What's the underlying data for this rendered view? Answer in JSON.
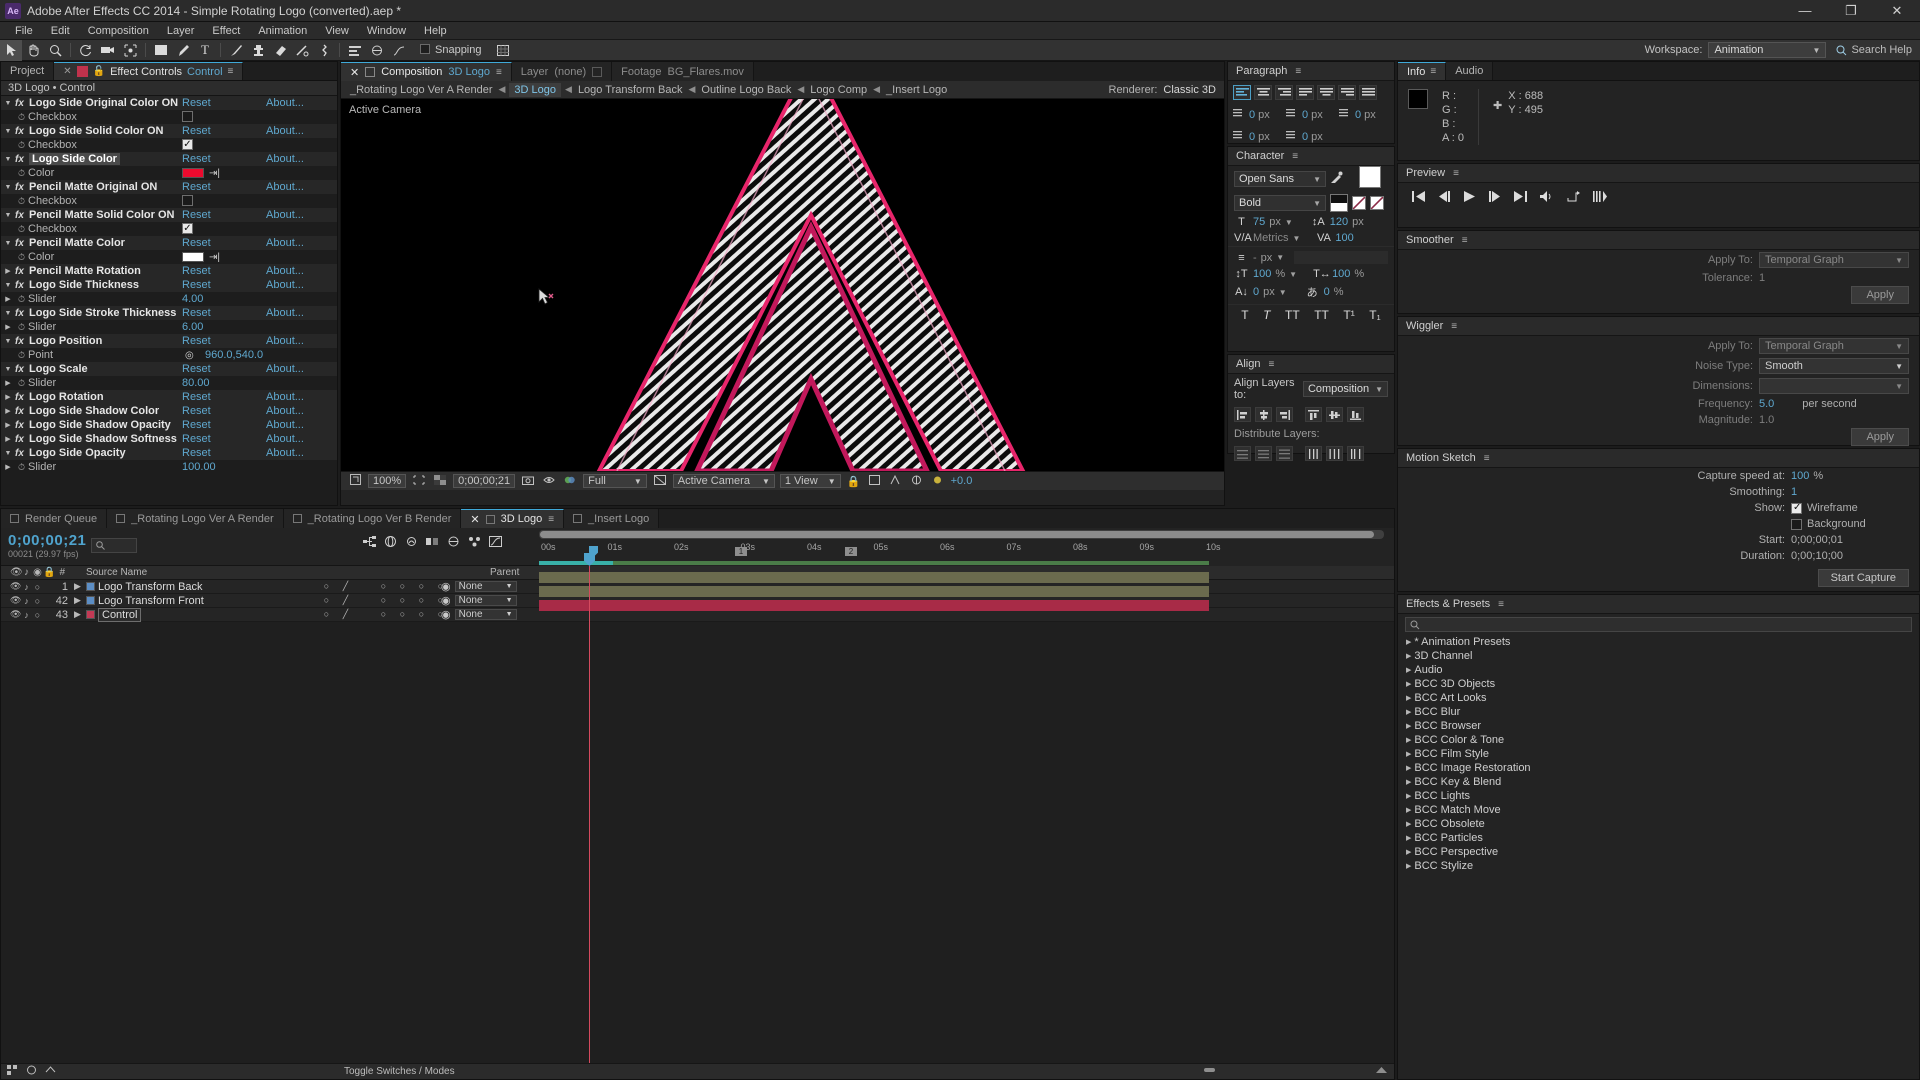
{
  "titlebar": {
    "app_badge": "Ae",
    "title": "Adobe After Effects CC 2014 - Simple Rotating Logo (converted).aep *",
    "minimize": "—",
    "maximize": "❐",
    "close": "✕"
  },
  "menubar": {
    "items": [
      "File",
      "Edit",
      "Composition",
      "Layer",
      "Effect",
      "Animation",
      "View",
      "Window",
      "Help"
    ]
  },
  "toolbar": {
    "snapping_label": "Snapping",
    "workspace_label": "Workspace:",
    "workspace_value": "Animation",
    "search_help_placeholder": "Search Help",
    "tools": [
      "selection-tool",
      "hand-tool",
      "zoom-tool",
      "rotation-tool",
      "camera-tool",
      "pan-behind-tool",
      "shape-tool",
      "pen-tool",
      "text-tool",
      "brush-tool",
      "clone-stamp-tool",
      "eraser-tool",
      "roto-brush-tool",
      "puppet-pin-tool"
    ]
  },
  "effect_controls": {
    "tabs": [
      {
        "label": "Project",
        "active": false
      },
      {
        "label": "Effect Controls",
        "suffix": "Control",
        "active": true
      }
    ],
    "subtitle": "3D Logo • Control",
    "reset_label": "Reset",
    "about_label": "About...",
    "rows": [
      {
        "type": "group",
        "name": "Logo Side Original Color ON",
        "highlight": false
      },
      {
        "type": "checkbox",
        "name": "Checkbox",
        "checked": false
      },
      {
        "type": "group",
        "name": "Logo Side Solid Color ON",
        "highlight": false
      },
      {
        "type": "checkbox",
        "name": "Checkbox",
        "checked": true
      },
      {
        "type": "group",
        "name": "Logo Side Color",
        "highlight": true
      },
      {
        "type": "color",
        "name": "Color",
        "value": "#ec0a2e"
      },
      {
        "type": "group",
        "name": "Pencil Matte Original Color ON",
        "label_override": "Pencil Matte Original ON",
        "highlight": false
      },
      {
        "type": "checkbox",
        "name": "Checkbox",
        "checked": false
      },
      {
        "type": "group",
        "name": "Pencil Matte Solid Color ON",
        "highlight": false
      },
      {
        "type": "checkbox",
        "name": "Checkbox",
        "checked": true
      },
      {
        "type": "group",
        "name": "Pencil Matte Color",
        "highlight": false
      },
      {
        "type": "color",
        "name": "Color",
        "value": "#ffffff"
      },
      {
        "type": "group-collapsed",
        "name": "Pencil Matte Rotation"
      },
      {
        "type": "group",
        "name": "Logo Side Thickness"
      },
      {
        "type": "slider",
        "name": "Slider",
        "value": "4.00"
      },
      {
        "type": "group",
        "name": "Logo Side Stroke Thickness"
      },
      {
        "type": "slider",
        "name": "Slider",
        "value": "6.00"
      },
      {
        "type": "group",
        "name": "Logo Position"
      },
      {
        "type": "point",
        "name": "Point",
        "value": "960.0,540.0"
      },
      {
        "type": "group",
        "name": "Logo Scale"
      },
      {
        "type": "slider",
        "name": "Slider",
        "value": "80.00"
      },
      {
        "type": "group-collapsed",
        "name": "Logo Rotation"
      },
      {
        "type": "group-collapsed",
        "name": "Logo Side Shadow Color"
      },
      {
        "type": "group-collapsed",
        "name": "Logo Side Shadow Opacity"
      },
      {
        "type": "group-collapsed",
        "name": "Logo Side Shadow Softness"
      },
      {
        "type": "group",
        "name": "Logo Side Opacity"
      },
      {
        "type": "slider",
        "name": "Slider",
        "value": "100.00"
      }
    ]
  },
  "composition": {
    "tabs": [
      {
        "label": "Composition",
        "value": "3D Logo",
        "active": true
      },
      {
        "label": "Layer",
        "value": "(none)",
        "active": false
      },
      {
        "label": "Footage",
        "value": "BG_Flares.mov",
        "active": false
      }
    ],
    "breadcrumbs": [
      {
        "label": "_Rotating Logo Ver A Render",
        "current": false
      },
      {
        "label": "3D Logo",
        "current": true
      },
      {
        "label": "Logo Transform Back",
        "current": false
      },
      {
        "label": "Outline Logo Back",
        "current": false
      },
      {
        "label": "Logo Comp",
        "current": false
      },
      {
        "label": "_Insert Logo",
        "current": false
      }
    ],
    "renderer_label": "Renderer:",
    "renderer_value": "Classic 3D",
    "active_camera_label": "Active Camera",
    "footer": {
      "zoom": "100%",
      "timecode": "0;00;00;21",
      "resolution": "Full",
      "view": "Active Camera",
      "views": "1 View",
      "exposure": "+0.0"
    }
  },
  "paragraph": {
    "title": "Paragraph",
    "fields": [
      {
        "icon": "indent-left-icon",
        "value": "0",
        "unit": "px"
      },
      {
        "icon": "indent-first-line-icon",
        "value": "0",
        "unit": "px"
      },
      {
        "icon": "space-before-icon",
        "value": "0",
        "unit": "px"
      },
      {
        "icon": "indent-right-icon",
        "value": "0",
        "unit": "px"
      },
      {
        "icon": "space-after-icon",
        "value": "0",
        "unit": "px"
      }
    ]
  },
  "character": {
    "title": "Character",
    "font_family": "Open Sans",
    "font_style": "Bold",
    "font_size": "75",
    "font_size_unit": "px",
    "leading": "120",
    "leading_unit": "px",
    "kerning": "Metrics",
    "tracking": "100",
    "stroke_width": "-",
    "stroke_width_unit": "px",
    "vertical_scale": "100",
    "horizontal_scale": "100",
    "baseline_shift": "0",
    "baseline_unit": "px",
    "tsume": "0",
    "tsume_unit": "%",
    "percent": "%",
    "styles": [
      "T",
      "T",
      "TT",
      "TT",
      "T¹",
      "T₁"
    ]
  },
  "align": {
    "title": "Align",
    "align_layers_label": "Align Layers to:",
    "align_layers_value": "Composition",
    "distribute_label": "Distribute Layers:"
  },
  "info": {
    "tabs": [
      "Info",
      "Audio"
    ],
    "r_label": "R :",
    "g_label": "G :",
    "b_label": "B :",
    "a_label": "A :",
    "a_value": "0",
    "x_label": "X :",
    "x_value": "688",
    "y_label": "Y :",
    "y_value": "495"
  },
  "preview": {
    "title": "Preview",
    "buttons": [
      "first-frame-icon",
      "previous-frame-icon",
      "play-icon",
      "next-frame-icon",
      "last-frame-icon",
      "audio-icon",
      "loop-icon",
      "ram-preview-icon"
    ]
  },
  "smoother": {
    "title": "Smoother",
    "apply_to_label": "Apply To:",
    "apply_to_value": "Temporal Graph",
    "tolerance_label": "Tolerance:",
    "tolerance_value": "1",
    "apply_label": "Apply"
  },
  "wiggler": {
    "title": "Wiggler",
    "apply_to_label": "Apply To:",
    "apply_to_value": "Temporal Graph",
    "noise_type_label": "Noise Type:",
    "noise_type_value": "Smooth",
    "dimensions_label": "Dimensions:",
    "dimensions_value": "",
    "frequency_label": "Frequency:",
    "frequency_value": "5.0",
    "frequency_unit": "per second",
    "magnitude_label": "Magnitude:",
    "magnitude_value": "1.0",
    "apply_label": "Apply"
  },
  "motion_sketch": {
    "title": "Motion Sketch",
    "capture_speed_label": "Capture speed at:",
    "capture_speed_value": "100",
    "capture_speed_unit": "%",
    "smoothing_label": "Smoothing:",
    "smoothing_value": "1",
    "show_label": "Show:",
    "wireframe_label": "Wireframe",
    "wireframe_checked": true,
    "background_label": "Background",
    "background_checked": false,
    "start_label": "Start:",
    "start_value": "0;00;00;01",
    "duration_label": "Duration:",
    "duration_value": "0;00;10;00",
    "start_capture_label": "Start Capture"
  },
  "effects_presets": {
    "title": "Effects & Presets",
    "search_placeholder": "",
    "items": [
      "* Animation Presets",
      "3D Channel",
      "Audio",
      "BCC 3D Objects",
      "BCC Art Looks",
      "BCC Blur",
      "BCC Browser",
      "BCC Color & Tone",
      "BCC Film Style",
      "BCC Image Restoration",
      "BCC Key & Blend",
      "BCC Lights",
      "BCC Match Move",
      "BCC Obsolete",
      "BCC Particles",
      "BCC Perspective",
      "BCC Stylize"
    ]
  },
  "timeline": {
    "tabs": [
      {
        "label": "Render Queue",
        "active": false
      },
      {
        "label": "_Rotating Logo Ver A Render",
        "active": false
      },
      {
        "label": "_Rotating Logo Ver B Render",
        "active": false
      },
      {
        "label": "3D Logo",
        "active": true
      },
      {
        "label": "_Insert Logo",
        "active": false
      }
    ],
    "current_time": "0;00;00;21",
    "frame_info": "00021 (29.97 fps)",
    "search_placeholder": "",
    "columns": {
      "source_name": "Source Name",
      "parent": "Parent"
    },
    "ruler_labels": [
      "00s",
      "01s",
      "02s",
      "03s",
      "04s",
      "05s",
      "06s",
      "07s",
      "08s",
      "09s",
      "10s"
    ],
    "layers": [
      {
        "index": "1",
        "name": "Logo Transform Back",
        "parent": "None",
        "swatch": "#5c8ec5",
        "bar_color": "#6b6b4e",
        "boxed": false
      },
      {
        "index": "42",
        "name": "Logo Transform Front",
        "parent": "None",
        "swatch": "#5c8ec5",
        "bar_color": "#6b6b4e",
        "boxed": false
      },
      {
        "index": "43",
        "name": "Control",
        "parent": "None",
        "swatch": "#c33a55",
        "bar_color": "#a82b47",
        "boxed": true
      }
    ],
    "footer_label": "Toggle Switches / Modes"
  }
}
